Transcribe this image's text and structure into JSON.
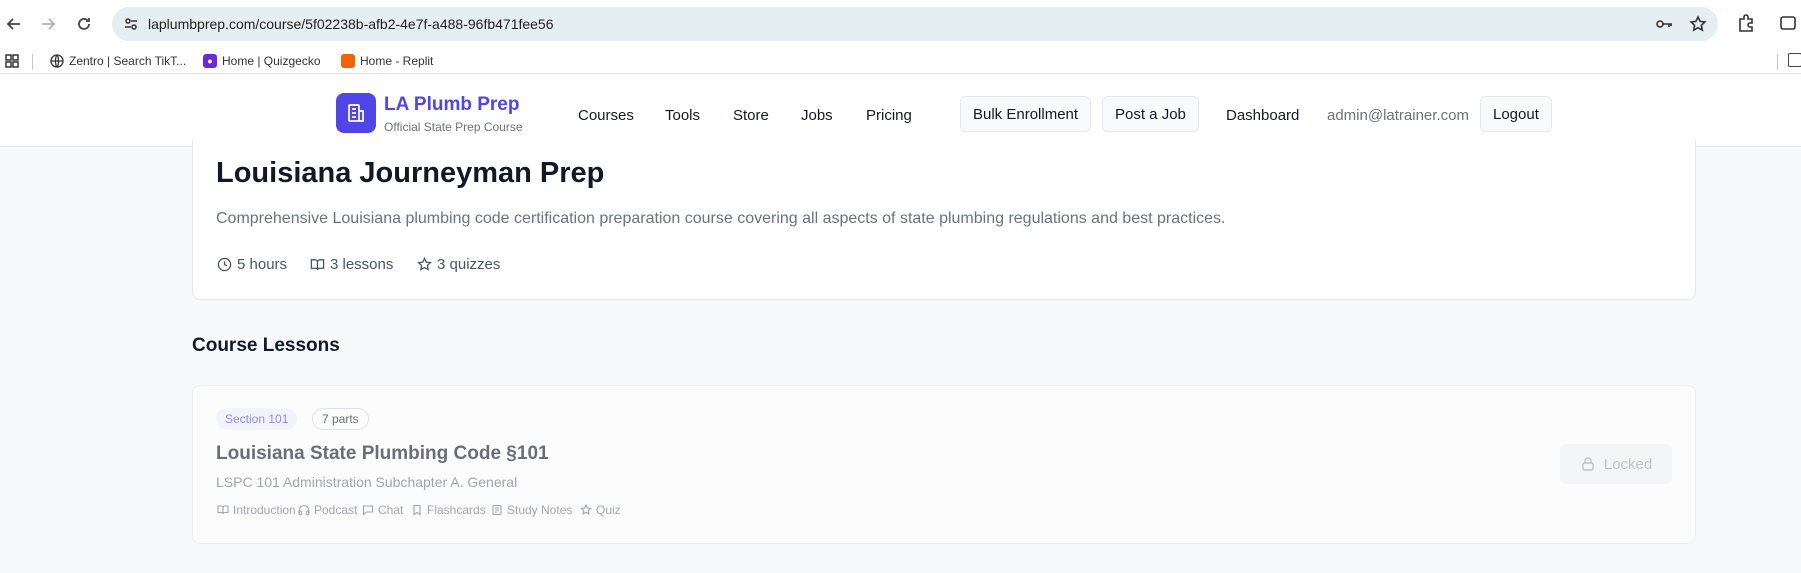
{
  "browser": {
    "url": "laplumbprep.com/course/5f02238b-afb2-4e7f-a488-96fb471fee56",
    "bookmarks": [
      {
        "label": "Zentro | Search TikT...",
        "icon": "globe-icon"
      },
      {
        "label": "Home | Quizgecko",
        "icon": "quizgecko-favicon"
      },
      {
        "label": "Home - Replit",
        "icon": "replit-favicon"
      }
    ]
  },
  "header": {
    "brand_title": "LA Plumb Prep",
    "brand_subtitle": "Official State Prep Course",
    "nav": [
      "Courses",
      "Tools",
      "Store",
      "Jobs",
      "Pricing"
    ],
    "bulk_enrollment": "Bulk Enrollment",
    "post_job": "Post a Job",
    "dashboard": "Dashboard",
    "user_email": "admin@latrainer.com",
    "logout": "Logout",
    "accent_color": "#4f46e5"
  },
  "course": {
    "title": "Louisiana Journeyman Prep",
    "description": "Comprehensive Louisiana plumbing code certification preparation course covering all aspects of state plumbing regulations and best practices.",
    "duration": "5 hours",
    "lessons": "3 lessons",
    "quizzes": "3 quizzes"
  },
  "lessons_section": {
    "heading": "Course Lessons",
    "items": [
      {
        "section": "Section 101",
        "parts_count": "7 parts",
        "title": "Louisiana State Plumbing Code §101",
        "subtitle": "LSPC 101 Administration Subchapter A. General",
        "parts": [
          "Introduction",
          "Podcast",
          "Chat",
          "Flashcards",
          "Study Notes",
          "Quiz"
        ],
        "status": "Locked"
      }
    ]
  }
}
